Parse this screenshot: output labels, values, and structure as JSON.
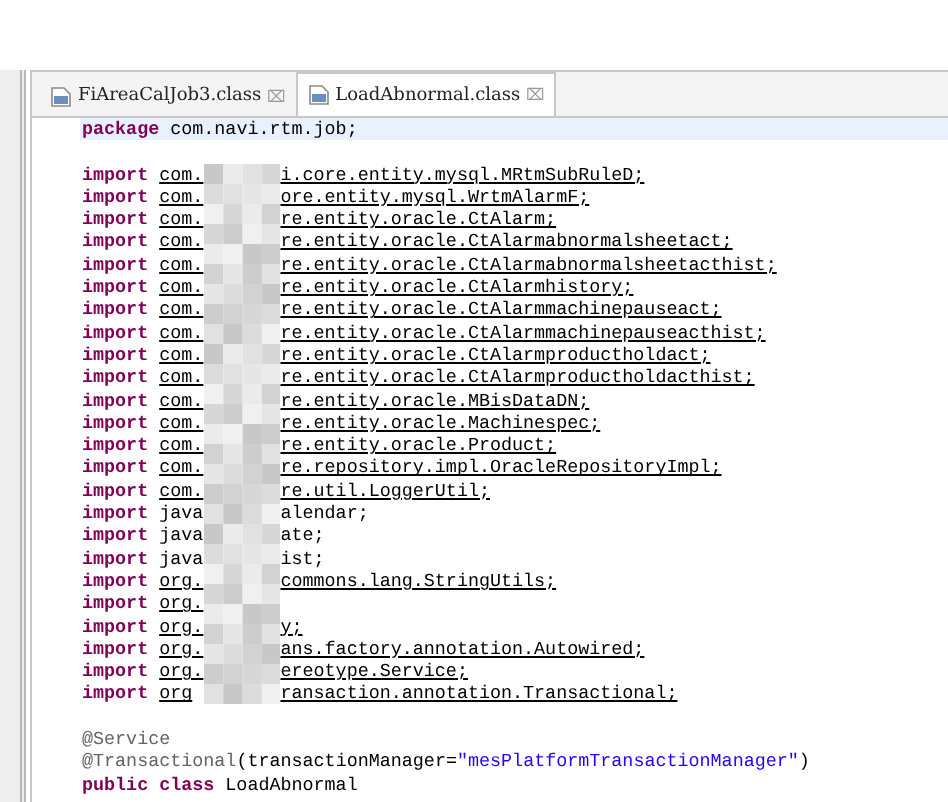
{
  "tabs": [
    {
      "label": "FiAreaCalJob3.class",
      "selected": false,
      "close": "⌧"
    },
    {
      "label": "LoadAbnormal.class",
      "selected": true,
      "close": "⌧"
    }
  ],
  "code_lines": [
    {
      "kind": "package",
      "keyword": "package",
      "text": "com.navi.rtm.job;",
      "current": true
    },
    {
      "kind": "blank"
    },
    {
      "kind": "import",
      "keyword": "import",
      "before": "com.",
      "after": "i.core.entity.mysql.MRtmSubRuleD;",
      "link": true
    },
    {
      "kind": "import",
      "keyword": "import",
      "before": "com.",
      "after": "ore.entity.mysql.WrtmAlarmF;",
      "link": true
    },
    {
      "kind": "import",
      "keyword": "import",
      "before": "com.",
      "after": "re.entity.oracle.CtAlarm;",
      "link": true
    },
    {
      "kind": "import",
      "keyword": "import",
      "before": "com.",
      "after": "re.entity.oracle.CtAlarmabnormalsheetact;",
      "link": true
    },
    {
      "kind": "import",
      "keyword": "import",
      "before": "com.",
      "after": "re.entity.oracle.CtAlarmabnormalsheetacthist;",
      "link": true
    },
    {
      "kind": "import",
      "keyword": "import",
      "before": "com.",
      "after": "re.entity.oracle.CtAlarmhistory;",
      "link": true
    },
    {
      "kind": "import",
      "keyword": "import",
      "before": "com.",
      "after": "re.entity.oracle.CtAlarmmachinepauseact;",
      "link": true
    },
    {
      "kind": "import",
      "keyword": "import",
      "before": "com.",
      "after": "re.entity.oracle.CtAlarmmachinepauseacthist;",
      "link": true
    },
    {
      "kind": "import",
      "keyword": "import",
      "before": "com.",
      "after": "re.entity.oracle.CtAlarmproductholdact;",
      "link": true
    },
    {
      "kind": "import",
      "keyword": "import",
      "before": "com.",
      "after": "re.entity.oracle.CtAlarmproductholdacthist;",
      "link": true
    },
    {
      "kind": "import",
      "keyword": "import",
      "before": "com.",
      "after": "re.entity.oracle.MBisDataDN;",
      "link": true
    },
    {
      "kind": "import",
      "keyword": "import",
      "before": "com.",
      "after": "re.entity.oracle.Machinespec;",
      "link": true
    },
    {
      "kind": "import",
      "keyword": "import",
      "before": "com.",
      "after": "re.entity.oracle.Product;",
      "link": true
    },
    {
      "kind": "import",
      "keyword": "import",
      "before": "com.",
      "after": "re.repository.impl.OracleRepositoryImpl;",
      "link": true
    },
    {
      "kind": "import",
      "keyword": "import",
      "before": "com.",
      "after": "re.util.LoggerUtil;",
      "link": true
    },
    {
      "kind": "import",
      "keyword": "import",
      "before": "java",
      "after": "alendar;",
      "link": false
    },
    {
      "kind": "import",
      "keyword": "import",
      "before": "java",
      "after": "ate;",
      "link": false
    },
    {
      "kind": "import",
      "keyword": "import",
      "before": "java",
      "after": "ist;",
      "link": false
    },
    {
      "kind": "import",
      "keyword": "import",
      "before": "org.",
      "after": "commons.lang.StringUtils;",
      "link": true
    },
    {
      "kind": "import",
      "keyword": "import",
      "before": "org.",
      "link": true
    },
    {
      "kind": "import",
      "keyword": "import",
      "before": "org.",
      "after": "y;",
      "link": true
    },
    {
      "kind": "import",
      "keyword": "import",
      "before": "org.",
      "after": "ans.factory.annotation.Autowired;",
      "link": true
    },
    {
      "kind": "import",
      "keyword": "import",
      "before": "org.",
      "after": "ereotype.Service;",
      "link": true
    },
    {
      "kind": "import",
      "keyword": "import",
      "before": "org",
      "after": "ransaction.annotation.Transactional;",
      "link": true
    },
    {
      "kind": "blank"
    },
    {
      "kind": "annotation",
      "annotation": "@Service"
    },
    {
      "kind": "annotation_call",
      "annotation": "@Transactional",
      "text": "(transactionManager=",
      "string": "\"mesPlatformTransactionManager\"",
      "end": ")"
    },
    {
      "kind": "declaration",
      "keyword": "public class",
      "text": "LoadAbnormal"
    }
  ]
}
